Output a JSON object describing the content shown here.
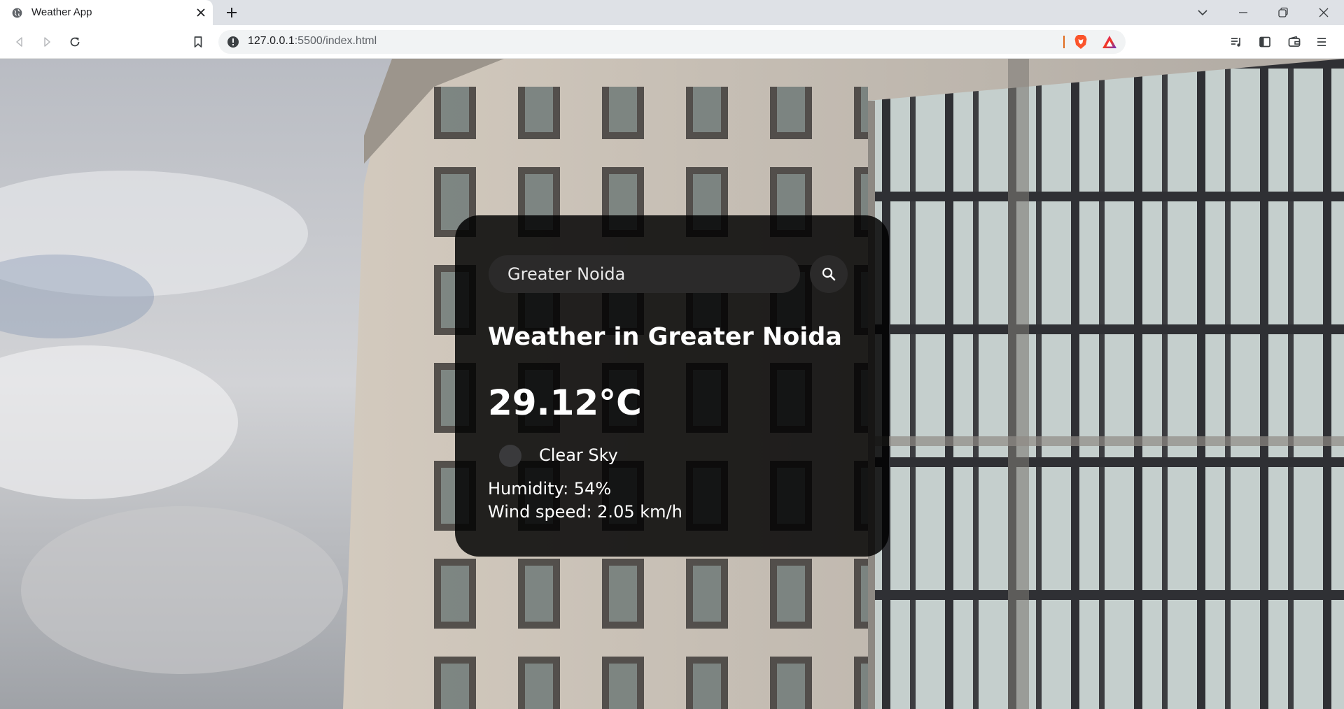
{
  "browser": {
    "tab": {
      "title": "Weather App"
    },
    "url": {
      "host": "127.0.0.1",
      "path": ":5500/index.html"
    }
  },
  "app": {
    "search": {
      "value": "Greater Noida"
    },
    "city_heading": "Weather in Greater Noida",
    "temperature": "29.12°C",
    "description": "Clear Sky",
    "humidity": "Humidity: 54%",
    "wind": "Wind speed: 2.05 km/h"
  },
  "colors": {
    "card_bg": "#000000d6",
    "input_bg": "#2b2a2a",
    "brave_orange": "#fb542b"
  },
  "icons": {
    "favicon": "globe-icon",
    "search": "search-icon",
    "weather": "weather-icon"
  }
}
